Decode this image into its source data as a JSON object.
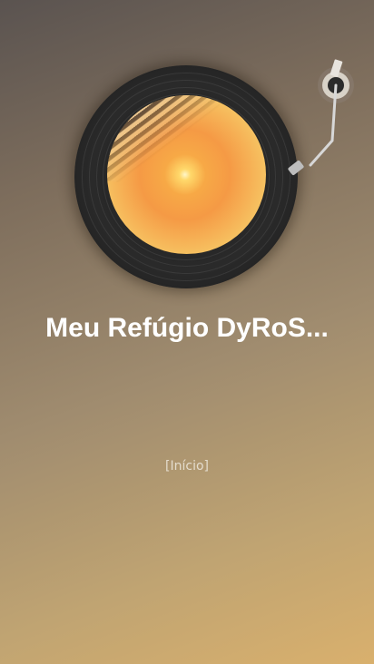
{
  "app": {
    "title": "Meu Refúgio DyRoS...",
    "home_link": "[Início]"
  },
  "icons": {
    "record": "vinyl-record-icon",
    "tonearm": "turntable-tonearm-icon",
    "cover": "album-cover-art"
  },
  "colors": {
    "background_top": "#5a5350",
    "background_bottom": "#d9b06d",
    "title": "#ffffff",
    "link": "#e4dccd"
  }
}
